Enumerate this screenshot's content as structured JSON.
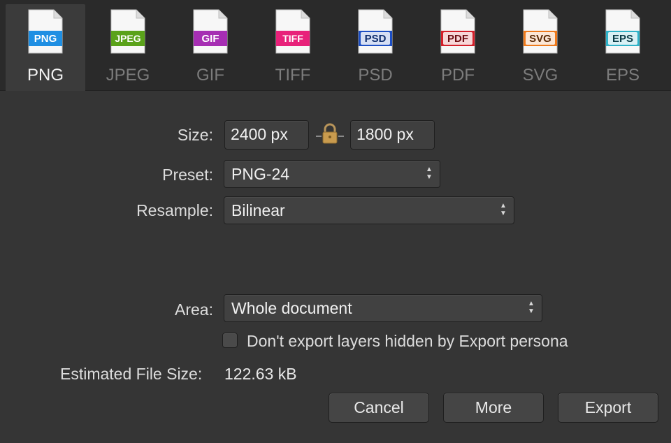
{
  "formats": [
    {
      "badge": "PNG",
      "label": "PNG",
      "color": "#1f8fe3",
      "badge_text_color": "#ffffff",
      "active": true
    },
    {
      "badge": "JPEG",
      "label": "JPEG",
      "color": "#5aa21a",
      "badge_text_color": "#ffffff",
      "active": false
    },
    {
      "badge": "GIF",
      "label": "GIF",
      "color": "#a62eb3",
      "badge_text_color": "#ffffff",
      "active": false
    },
    {
      "badge": "TIFF",
      "label": "TIFF",
      "color": "#e8217a",
      "badge_text_color": "#ffffff",
      "active": false
    },
    {
      "badge": "PSD",
      "label": "PSD",
      "color": "#1d4fc4",
      "badge_text_color": "#0f2e6e",
      "active": false
    },
    {
      "badge": "PDF",
      "label": "PDF",
      "color": "#d41f2a",
      "badge_text_color": "#6b0c12",
      "active": false
    },
    {
      "badge": "SVG",
      "label": "SVG",
      "color": "#ee7a1c",
      "badge_text_color": "#5a2a06",
      "active": false
    },
    {
      "badge": "EPS",
      "label": "EPS",
      "color": "#2fb2c8",
      "badge_text_color": "#0b3c47",
      "active": false
    }
  ],
  "size": {
    "label": "Size:",
    "width_value": "2400 px",
    "height_value": "1800 px",
    "lock_icon": "lock-icon"
  },
  "preset": {
    "label": "Preset:",
    "value": "PNG-24"
  },
  "resample": {
    "label": "Resample:",
    "value": "Bilinear"
  },
  "area": {
    "label": "Area:",
    "value": "Whole document"
  },
  "hidden_layers_checkbox": {
    "label": "Don't export layers hidden by Export persona",
    "checked": false
  },
  "estimate": {
    "label": "Estimated File Size:",
    "value": "122.63 kB"
  },
  "buttons": {
    "cancel": "Cancel",
    "more": "More",
    "export": "Export"
  },
  "arrows": {
    "up": "▲",
    "down": "▼"
  }
}
